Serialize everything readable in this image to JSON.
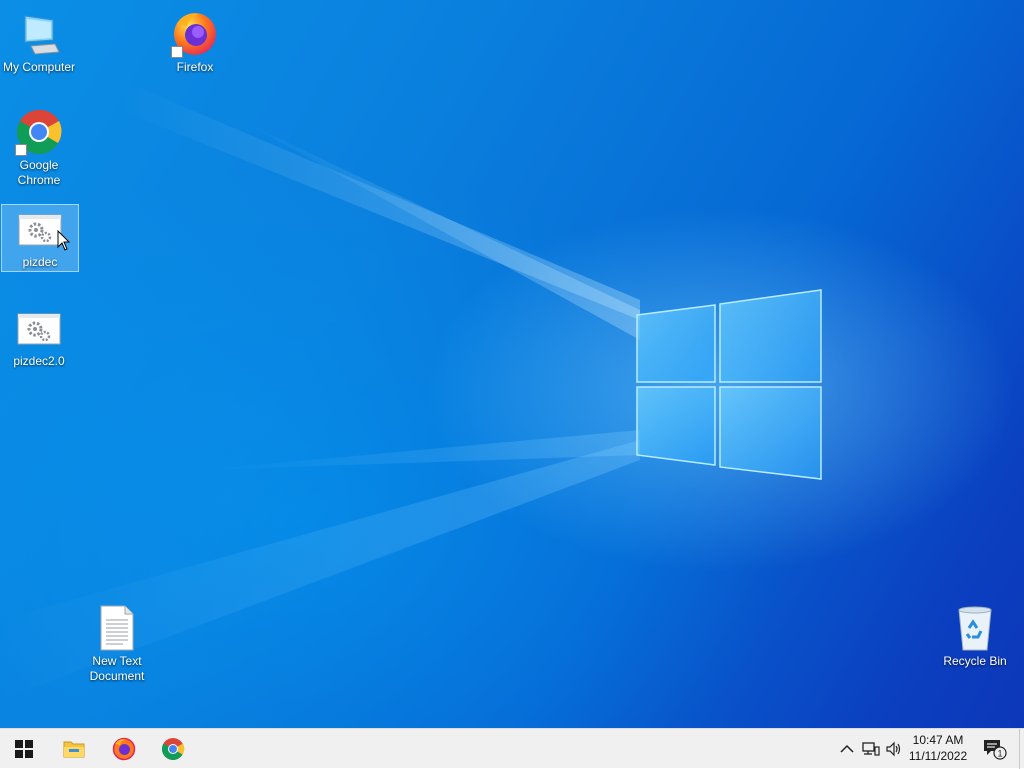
{
  "desktop": {
    "icons": [
      {
        "label": "My Computer",
        "icon": "computer-icon"
      },
      {
        "label": "Firefox",
        "icon": "firefox-icon"
      },
      {
        "label": "Google Chrome",
        "icon": "chrome-icon"
      },
      {
        "label": "pizdec",
        "icon": "application-gears-icon",
        "selected": true
      },
      {
        "label": "pizdec2.0",
        "icon": "application-gears-icon"
      },
      {
        "label": "New Text Document",
        "icon": "text-document-icon"
      },
      {
        "label": "Recycle Bin",
        "icon": "recycle-bin-icon"
      }
    ]
  },
  "taskbar": {
    "start_icon": "windows-start-icon",
    "pinned": [
      {
        "name": "File Explorer",
        "icon": "folder-icon"
      },
      {
        "name": "Firefox",
        "icon": "firefox-icon"
      },
      {
        "name": "Google Chrome",
        "icon": "chrome-icon"
      }
    ],
    "tray": {
      "chevron": "^",
      "network_icon": "network-icon",
      "volume_icon": "volume-icon",
      "time": "10:47 AM",
      "date": "11/11/2022",
      "notification_icon": "notification-icon",
      "notification_count": "1"
    }
  },
  "colors": {
    "desktop_blue": "#0a7fdd",
    "taskbar_bg": "#f0f0f0"
  }
}
